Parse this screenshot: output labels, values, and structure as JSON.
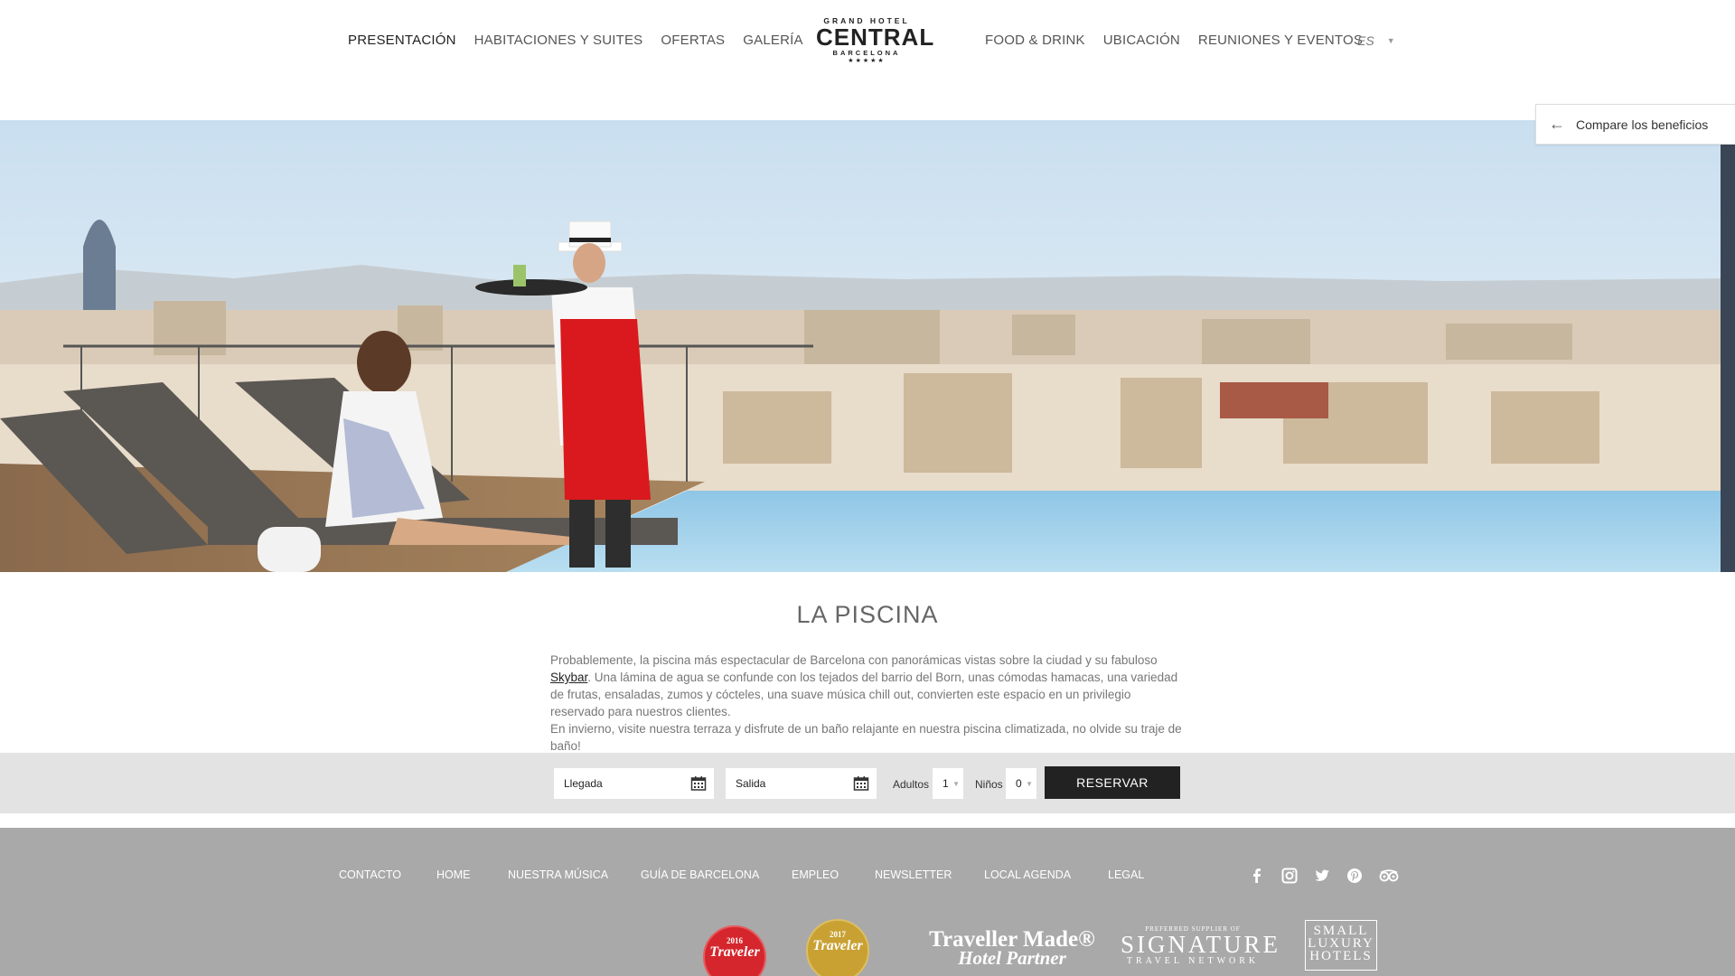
{
  "header": {
    "nav_left": [
      {
        "label": "PRESENTACIÓN",
        "active": true
      },
      {
        "label": "HABITACIONES Y SUITES",
        "active": false
      },
      {
        "label": "OFERTAS",
        "active": false
      },
      {
        "label": "GALERÍA",
        "active": false
      }
    ],
    "nav_right": [
      {
        "label": "FOOD & DRINK"
      },
      {
        "label": "UBICACIÓN"
      },
      {
        "label": "REUNIONES Y EVENTOS"
      }
    ],
    "logo": {
      "top": "GRAND HOTEL",
      "main": "CENTRAL",
      "sub": "BARCELONA",
      "stars": "★★★★★"
    },
    "language": "ES"
  },
  "compare_panel": {
    "label": "Compare los beneficios",
    "icon": "arrow-left-icon"
  },
  "hero": {
    "alt_icon": "rooftop-pool-photo"
  },
  "content": {
    "title": "LA PISCINA",
    "paragraph1_before": "Probablemente, la piscina más espectacular de Barcelona con panorámicas vistas sobre la ciudad y su fabuloso ",
    "paragraph1_link": "Skybar",
    "paragraph1_after": ". Una lámina de agua se confunde con los tejados del barrio del Born, unas cómodas hamacas, una variedad de frutas, ensaladas, zumos y cócteles, una suave música chill out, convierten este espacio en un privilegio reservado para nuestros clientes.",
    "paragraph2": "En invierno, visite nuestra terraza y disfrute de un baño relajante en nuestra piscina climatizada, no olvide su traje de baño!"
  },
  "booking": {
    "arrival_placeholder": "Llegada",
    "departure_placeholder": "Salida",
    "adults_label": "Adultos",
    "adults_value": "1",
    "children_label": "Niños",
    "children_value": "0",
    "reserve_label": "RESERVAR"
  },
  "footer": {
    "links": [
      "CONTACTO",
      "HOME",
      "NUESTRA MÚSICA",
      "GUÍA DE BARCELONA",
      "EMPLEO",
      "NEWSLETTER",
      "LOCAL AGENDA",
      "LEGAL"
    ],
    "social_icons": [
      "facebook-icon",
      "instagram-icon",
      "twitter-icon",
      "pinterest-icon",
      "tripadvisor-icon"
    ],
    "awards": {
      "cn2016_year": "2016",
      "cn2016_name": "Traveler",
      "cn2017_year": "2017",
      "cn2017_name": "Traveler",
      "tm_line1": "Traveller Made®",
      "tm_line2": "Hotel Partner",
      "sig_small": "PREFERRED SUPPLIER OF",
      "sig_main": "SIGNATURE",
      "sig_sub": "TRAVEL NETWORK",
      "slh": "SMALL LUXURY HOTELS"
    },
    "colors": {
      "background": "#a9a9a9",
      "cn2016": "#d4262c",
      "cn2017": "#c9a133"
    }
  }
}
